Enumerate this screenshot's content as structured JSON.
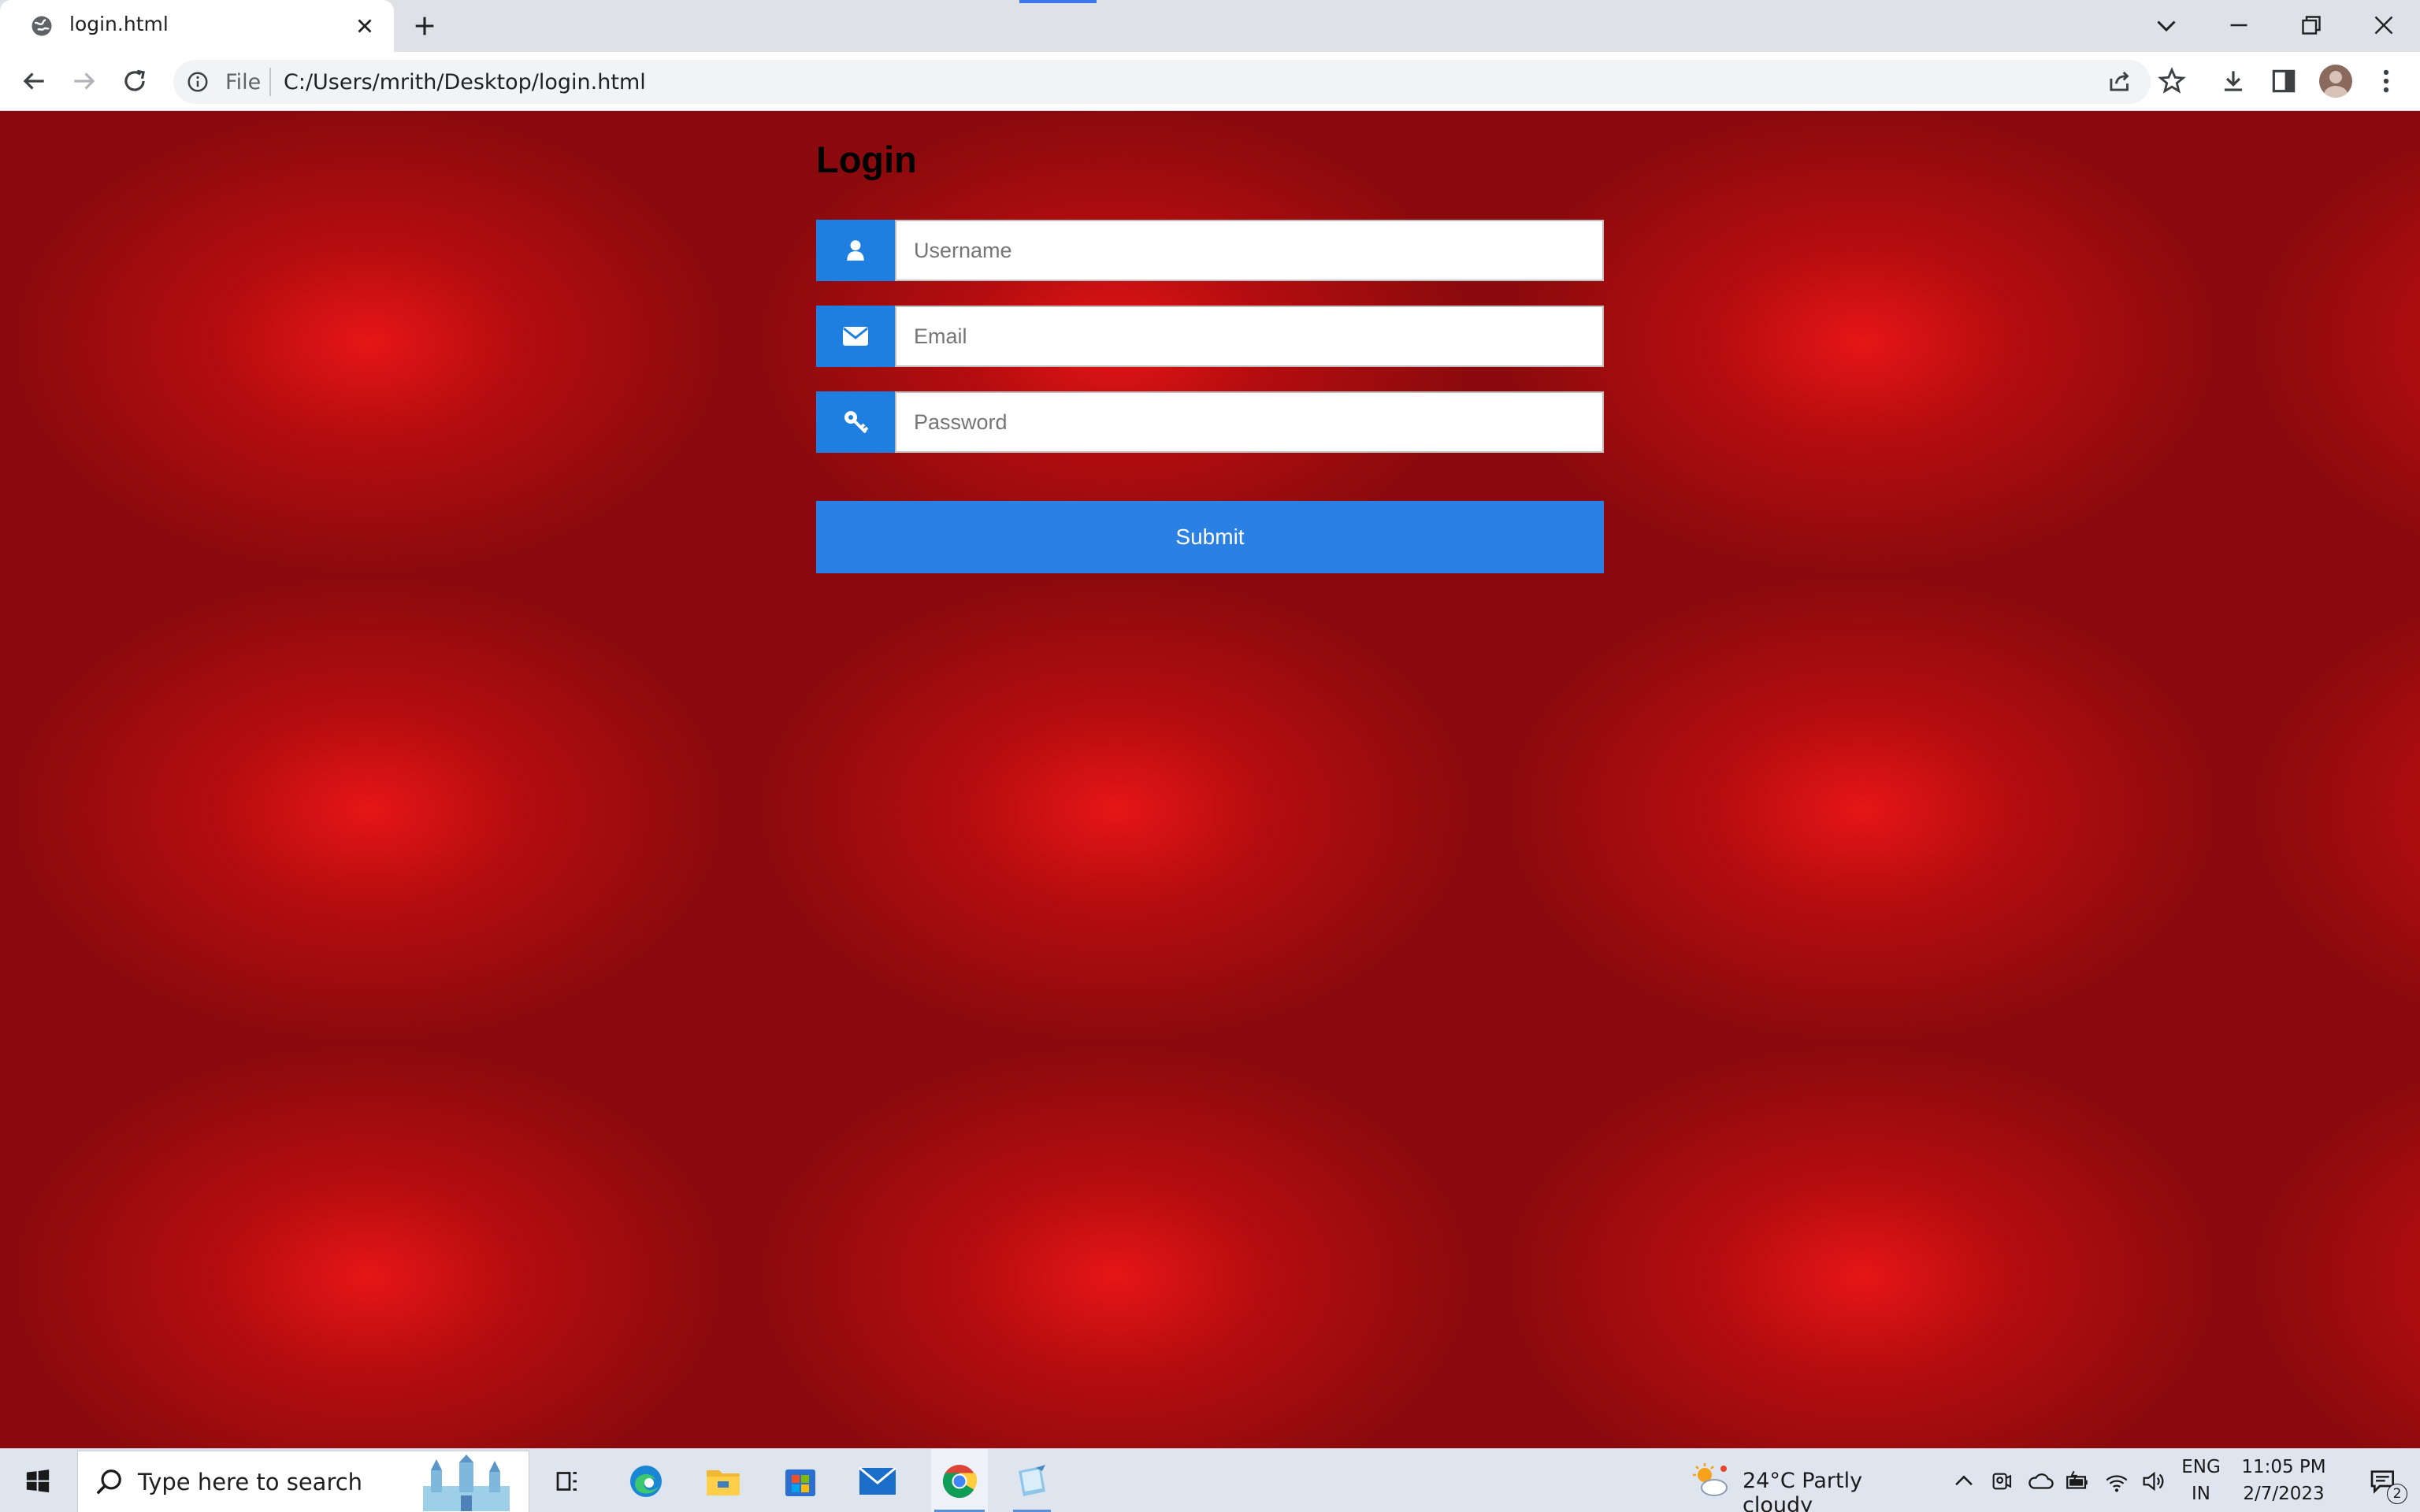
{
  "browser": {
    "tab_title": "login.html",
    "url_scheme": "File",
    "url": "C:/Users/mrith/Desktop/login.html",
    "accent": "#3b78e7"
  },
  "page": {
    "heading": "Login",
    "username_placeholder": "Username",
    "email_placeholder": "Email",
    "password_placeholder": "Password",
    "submit_label": "Submit",
    "icon_color": "#1f7fe0",
    "button_color": "#2a81e3",
    "background_color": "#c81010"
  },
  "taskbar": {
    "search_placeholder": "Type here to search",
    "weather": "24°C  Partly cloudy",
    "lang_top": "ENG",
    "lang_bottom": "IN",
    "time": "11:05 PM",
    "date": "2/7/2023",
    "notification_count": "2"
  }
}
